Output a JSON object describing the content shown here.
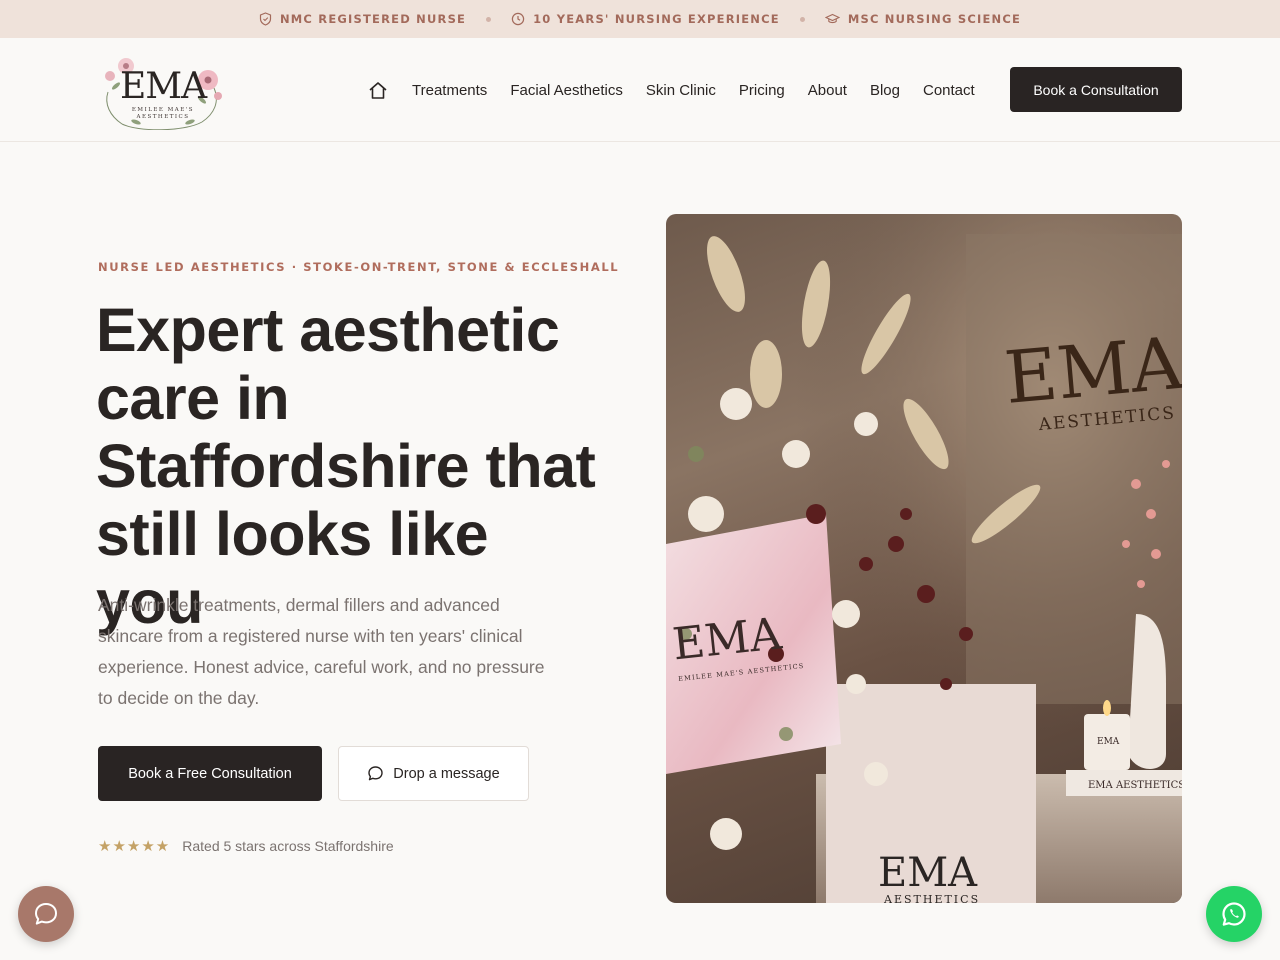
{
  "topbar": {
    "items": [
      {
        "icon": "shield-icon",
        "label": "NMC REGISTERED NURSE"
      },
      {
        "icon": "clock-icon",
        "label": "10 YEARS' NURSING EXPERIENCE"
      },
      {
        "icon": "graduation-cap-icon",
        "label": "MSC NURSING SCIENCE"
      }
    ]
  },
  "logo": {
    "mono": "EMA",
    "sub": "EMILEE MAE'S AESTHETICS"
  },
  "nav": {
    "home_icon": "home-icon",
    "items": [
      "Treatments",
      "Facial Aesthetics",
      "Skin Clinic",
      "Pricing",
      "About",
      "Blog",
      "Contact"
    ],
    "cta": "Book a Consultation"
  },
  "hero": {
    "eyebrow": "NURSE LED AESTHETICS · STOKE-ON-TRENT, STONE & ECCLESHALL",
    "headline": "Expert aesthetic care in Staffordshire that still looks like you",
    "lede": "Anti-wrinkle treatments, dermal fillers and advanced skincare from a registered nurse with ten years' clinical experience. Honest advice, careful work, and no pressure to decide on the day.",
    "primary_cta": "Book a Free Consultation",
    "secondary_cta": "Drop a message",
    "secondary_icon": "message-bubble-icon",
    "stars": "★★★★★",
    "rating_value": 5,
    "rating_text": "Rated 5 stars across Staffordshire"
  },
  "image": {
    "sign_main": "EMA",
    "sign_sub": "AESTHETICS",
    "card_mono": "EMA",
    "card_sub": "EMILEE MAE'S AESTHETICS",
    "book_text": "EMA AESTHETICS",
    "candle_label": "EMA",
    "box_main": "EMA",
    "box_sub": "AESTHETICS"
  },
  "fabs": {
    "chat_icon": "chat-icon",
    "whatsapp_icon": "whatsapp-icon"
  },
  "colors": {
    "accent": "#b06d5d",
    "dark": "#292423",
    "topbar_bg": "#efe2da",
    "whatsapp": "#25d366",
    "chat": "#a8786a",
    "star": "#c4a266"
  }
}
